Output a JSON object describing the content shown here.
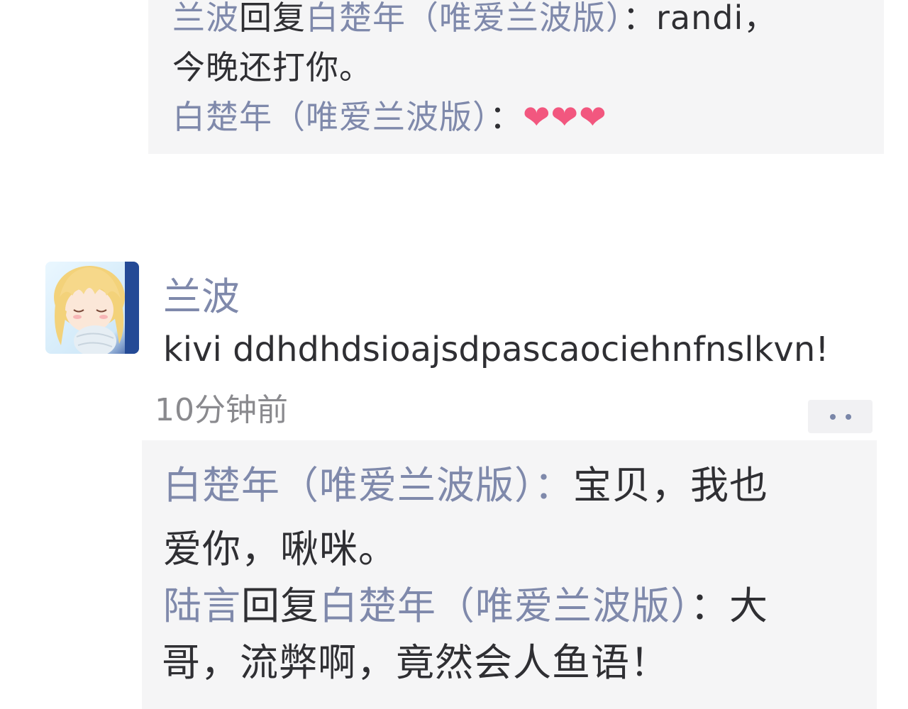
{
  "top_reply_box": {
    "line1": {
      "from": "兰波",
      "verb": "回复",
      "to": "白楚年（唯爱兰波版）",
      "colon": "：",
      "text": "randi，"
    },
    "line2": {
      "text": "今晚还打你。"
    },
    "line3": {
      "from": "白楚年（唯爱兰波版）",
      "colon": "：",
      "hearts": "❤❤❤"
    }
  },
  "comment": {
    "avatar_label": "anime-avatar",
    "author": "兰波",
    "text": "kivi ddhdhdsioajsdpascaociehnfnslkvn!",
    "timestamp": "10分钟前",
    "more_button": "more-options"
  },
  "bottom_reply_box": {
    "line1": {
      "from": "白楚年（唯爱兰波版）",
      "colon": "：",
      "text": "宝贝，我也"
    },
    "line2": {
      "text": "爱你，啾咪。"
    },
    "line3": {
      "from": "陆言",
      "verb": "回复",
      "to": "白楚年（唯爱兰波版）",
      "colon": "：",
      "text": "大"
    },
    "line4": {
      "text": "哥，流弊啊，竟然会人鱼语！"
    }
  }
}
